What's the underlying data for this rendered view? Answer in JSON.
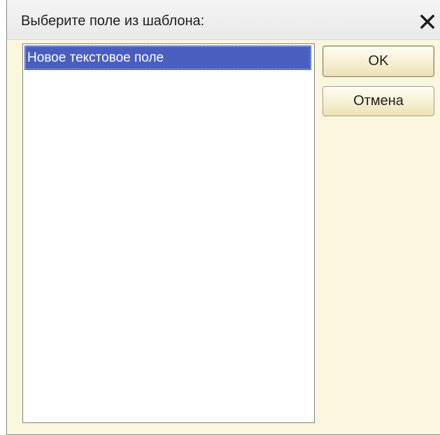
{
  "dialog": {
    "title": "Выберите поле из шаблона:",
    "close_icon": "close-icon",
    "colors": {
      "background": "#fbf6de",
      "selection": "#4a5ec0"
    }
  },
  "list": {
    "items": [
      {
        "label": "Новое текстовое поле",
        "selected": true
      }
    ]
  },
  "buttons": {
    "ok_label": "OK",
    "cancel_label": "Отмена"
  }
}
